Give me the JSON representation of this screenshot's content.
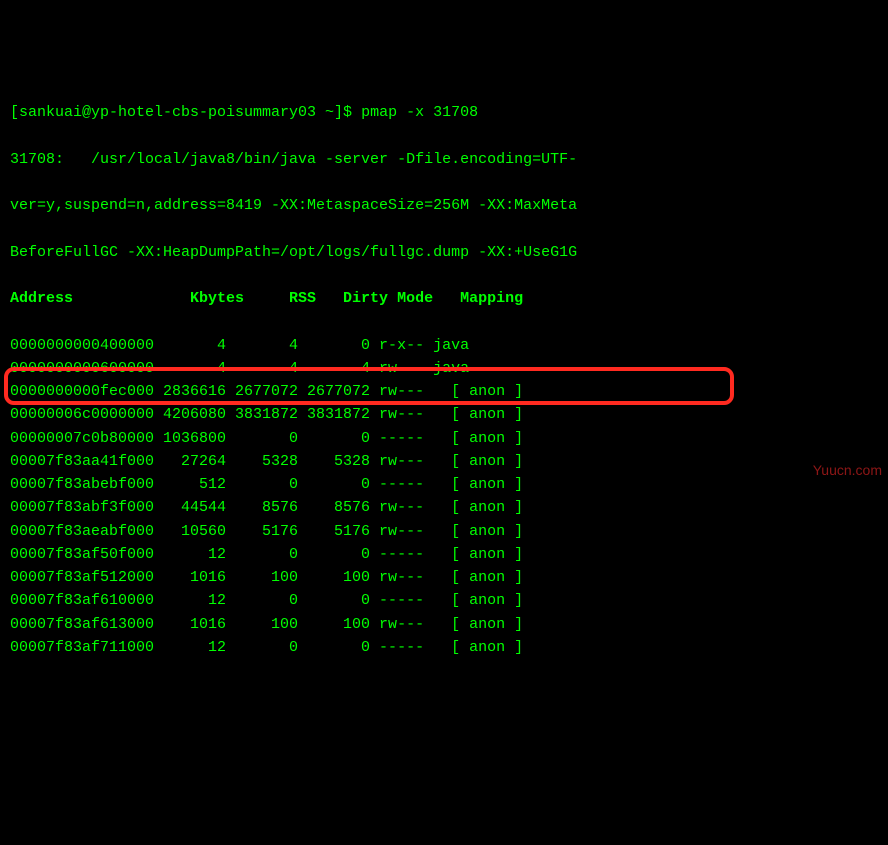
{
  "prompt": {
    "user_host": "[sankuai@yp-hotel-cbs-poisummary03 ~]$ ",
    "command": "pmap -x 31708"
  },
  "process_line1": "31708:   /usr/local/java8/bin/java -server -Dfile.encoding=UTF-",
  "process_line2": "ver=y,suspend=n,address=8419 -XX:MetaspaceSize=256M -XX:MaxMeta",
  "process_line3": "BeforeFullGC -XX:HeapDumpPath=/opt/logs/fullgc.dump -XX:+UseG1G",
  "headers": {
    "address": "Address",
    "kbytes": "Kbytes",
    "rss": "RSS",
    "dirty": "Dirty",
    "mode": "Mode",
    "mapping": "Mapping"
  },
  "rows": [
    {
      "address": "0000000000400000",
      "kbytes": "4",
      "rss": "4",
      "dirty": "0",
      "mode": "r-x--",
      "mapping": "java"
    },
    {
      "address": "0000000000600000",
      "kbytes": "4",
      "rss": "4",
      "dirty": "4",
      "mode": "rw---",
      "mapping": "java"
    },
    {
      "address": "0000000000fec000",
      "kbytes": "2836616",
      "rss": "2677072",
      "dirty": "2677072",
      "mode": "rw---",
      "mapping": "  [ anon ]"
    },
    {
      "address": "00000006c0000000",
      "kbytes": "4206080",
      "rss": "3831872",
      "dirty": "3831872",
      "mode": "rw---",
      "mapping": "  [ anon ]"
    },
    {
      "address": "00000007c0b80000",
      "kbytes": "1036800",
      "rss": "0",
      "dirty": "0",
      "mode": "-----",
      "mapping": "  [ anon ]"
    },
    {
      "address": "00007f83aa41f000",
      "kbytes": "27264",
      "rss": "5328",
      "dirty": "5328",
      "mode": "rw---",
      "mapping": "  [ anon ]"
    },
    {
      "address": "00007f83abebf000",
      "kbytes": "512",
      "rss": "0",
      "dirty": "0",
      "mode": "-----",
      "mapping": "  [ anon ]"
    },
    {
      "address": "00007f83abf3f000",
      "kbytes": "44544",
      "rss": "8576",
      "dirty": "8576",
      "mode": "rw---",
      "mapping": "  [ anon ]"
    },
    {
      "address": "00007f83aeabf000",
      "kbytes": "10560",
      "rss": "5176",
      "dirty": "5176",
      "mode": "rw---",
      "mapping": "  [ anon ]"
    },
    {
      "address": "00007f83af50f000",
      "kbytes": "12",
      "rss": "0",
      "dirty": "0",
      "mode": "-----",
      "mapping": "  [ anon ]"
    },
    {
      "address": "00007f83af512000",
      "kbytes": "1016",
      "rss": "100",
      "dirty": "100",
      "mode": "rw---",
      "mapping": "  [ anon ]"
    },
    {
      "address": "00007f83af610000",
      "kbytes": "12",
      "rss": "0",
      "dirty": "0",
      "mode": "-----",
      "mapping": "  [ anon ]"
    },
    {
      "address": "00007f83af613000",
      "kbytes": "1016",
      "rss": "100",
      "dirty": "100",
      "mode": "rw---",
      "mapping": "  [ anon ]"
    },
    {
      "address": "00007f83af711000",
      "kbytes": "12",
      "rss": "0",
      "dirty": "0",
      "mode": "-----",
      "mapping": "  [ anon ]"
    }
  ],
  "highlight_row_index": 2,
  "watermark": "Yuucn.com"
}
